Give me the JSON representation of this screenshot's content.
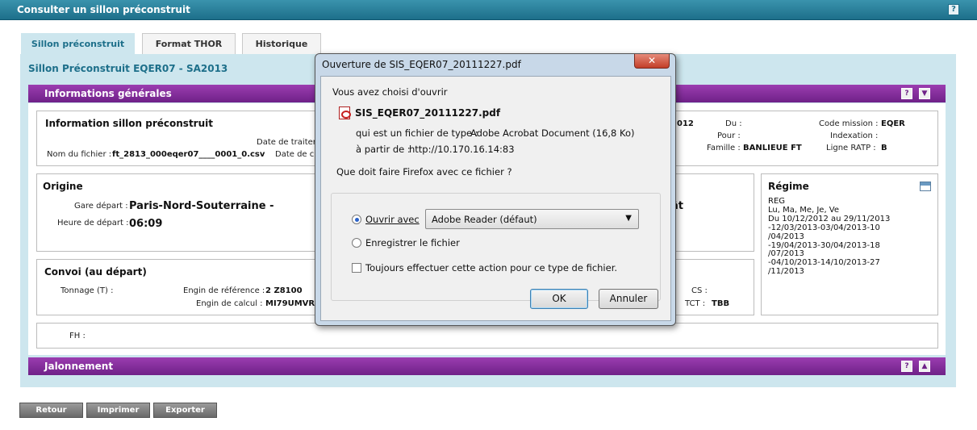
{
  "window": {
    "title": "Consulter un sillon préconstruit",
    "help": "?"
  },
  "tabs": [
    {
      "label": "Sillon préconstruit"
    },
    {
      "label": "Format THOR"
    },
    {
      "label": "Historique"
    }
  ],
  "subtitle": "Sillon Préconstruit EQER07 - SA2013",
  "sections": {
    "info": "Informations générales",
    "jalonnement": "Jalonnement",
    "help": "?",
    "collapse": "▼",
    "expand": "▲"
  },
  "info_sillon": {
    "title": "Information sillon préconstruit",
    "date_traitement_label": "Date de traiter",
    "nom_fichier_label": "Nom du fichier :",
    "nom_fichier_value": "ft_2813_000eqer07____0001_0.csv",
    "date_c_label": "Date de c",
    "partial_value": "012",
    "du_label": "Du :",
    "pour_label": "Pour :",
    "famille_label": "Famille :",
    "famille_value": "BANLIEUE FT",
    "code_mission_label": "Code mission :",
    "code_mission_value": "EQER",
    "indexation_label": "Indexation :",
    "ligne_ratp_label": "Ligne RATP :",
    "ligne_ratp_value": "B"
  },
  "origine": {
    "title": "Origine",
    "gare_label": "Gare départ :",
    "gare_value": "Paris-Nord-Souterraine -",
    "heure_label": "Heure de départ :",
    "heure_value": "06:09",
    "right_partial": "ât"
  },
  "regime": {
    "title": "Régime",
    "lines": [
      "REG",
      "Lu, Ma, Me, Je, Ve",
      "Du 10/12/2012 au 29/11/2013",
      "-12/03/2013-03/04/2013-10",
      "/04/2013",
      "-19/04/2013-30/04/2013-18",
      "/07/2013",
      "-04/10/2013-14/10/2013-27",
      "/11/2013"
    ]
  },
  "convoi": {
    "title": "Convoi (au départ)",
    "tonnage_label": "Tonnage (T) :",
    "engin_ref_label": "Engin de référence :",
    "engin_ref_value": "2 Z8100",
    "engin_calc_label": "Engin de calcul :",
    "engin_calc_value": "MI79UMVR E",
    "cs_label": "CS :",
    "tct_label": "TCT :",
    "tct_value": "TBB"
  },
  "fh": {
    "label": "FH :"
  },
  "bottom_buttons": [
    "Retour",
    "Imprimer",
    "Exporter"
  ],
  "dialog": {
    "title": "Ouverture de SIS_EQER07_20111227.pdf",
    "close": "✕",
    "intro": "Vous avez choisi d'ouvrir",
    "filename": "SIS_EQER07_20111227.pdf",
    "type_label": "qui est un fichier de type :",
    "type_value": "Adobe Acrobat Document (16,8 Ko)",
    "from_label": "à partir de :",
    "from_value": "http://10.170.16.14:83",
    "question": "Que doit faire Firefox avec ce fichier ?",
    "open_with_label": "Ouvrir avec",
    "open_with_value": "Adobe Reader  (défaut)",
    "save_label": "Enregistrer le fichier",
    "always_label": "Toujours effectuer cette action pour ce type de fichier.",
    "ok": "OK",
    "cancel": "Annuler"
  },
  "colors": {
    "header": "#1d6f8a",
    "section": "#7b2a96",
    "content_bg": "#cde6ee"
  }
}
